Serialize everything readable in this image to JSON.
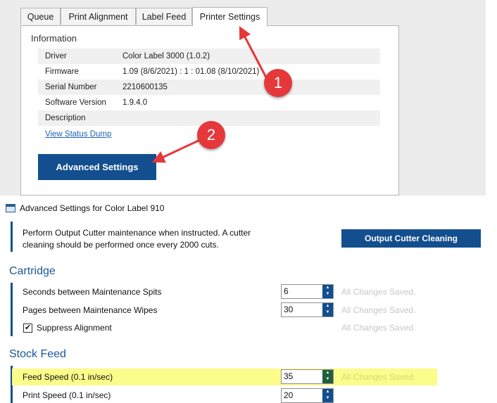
{
  "tabs": [
    "Queue",
    "Print Alignment",
    "Label Feed",
    "Printer Settings"
  ],
  "info": {
    "heading": "Information",
    "rows": [
      {
        "label": "Driver",
        "value": "Color Label 3000 (1.0.2)"
      },
      {
        "label": "Firmware",
        "value": "1.09 (8/6/2021) : 1 : 01.08 (8/10/2021)"
      },
      {
        "label": "Serial Number",
        "value": "2210600135"
      },
      {
        "label": "Software Version",
        "value": "1.9.4.0"
      },
      {
        "label": "Description",
        "value": ""
      }
    ],
    "status_link": "View Status Dump",
    "advanced_button": "Advanced Settings"
  },
  "annotations": {
    "step1": "1",
    "step2": "2",
    "color": "#e5383b"
  },
  "advanced": {
    "window_title": "Advanced Settings for Color Label 910",
    "cutter_text": "Perform Output Cutter maintenance when instructed. A cutter cleaning should be performed once every 2000 cuts.",
    "cutter_button": "Output Cutter Cleaning",
    "cartridge": {
      "title": "Cartridge",
      "spits_label": "Seconds between Maintenance Spits",
      "spits_value": "6",
      "spits_status": "All Changes Saved.",
      "wipes_label": "Pages between Maintenance Wipes",
      "wipes_value": "30",
      "wipes_status": "All Changes Saved.",
      "suppress_label": "Suppress Alignment",
      "suppress_checked": true,
      "suppress_check_glyph": "✔",
      "suppress_status": "All Changes Saved."
    },
    "stock_feed": {
      "title": "Stock Feed",
      "feed_label": "Feed Speed (0.1 in/sec)",
      "feed_value": "35",
      "feed_status": "All Changes Saved.",
      "print_label": "Print Speed (0.1 in/sec)",
      "print_value": "20",
      "highlight_color": "#fcfc8a"
    },
    "accent_color": "#134f8f"
  }
}
